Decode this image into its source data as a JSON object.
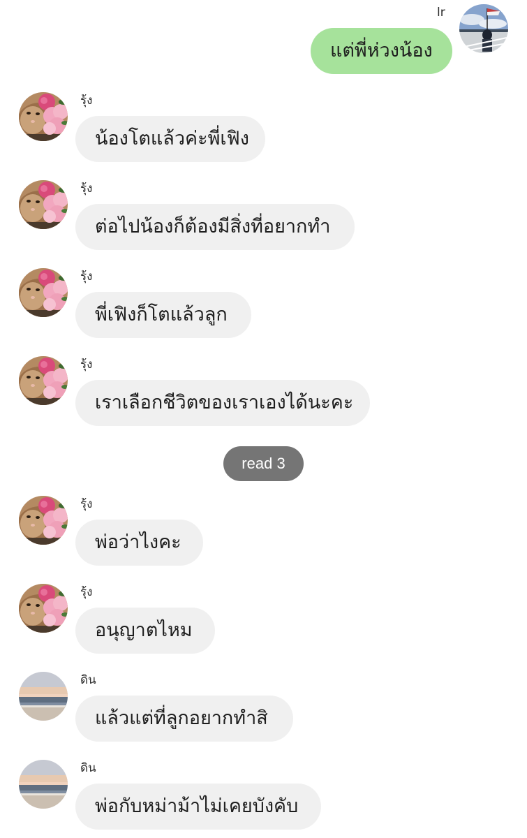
{
  "outgoing": {
    "sender_name": "lr",
    "text": "แต่พี่ห่วงน้อง",
    "avatar": "sea-view-photo-avatar"
  },
  "messages": [
    {
      "sender": "รุ้ง",
      "text": "น้องโตแล้วค่ะพี่เฟิง",
      "avatar": "cat-with-flowers-avatar"
    },
    {
      "sender": "รุ้ง",
      "text": "ต่อไปน้องก็ต้องมีสิ่งที่อยากทำ",
      "avatar": "cat-with-flowers-avatar"
    },
    {
      "sender": "รุ้ง",
      "text": "พี่เฟิงก็โตแล้วลูก",
      "avatar": "cat-with-flowers-avatar"
    },
    {
      "sender": "รุ้ง",
      "text": "เราเลือกชีวิตของเราเองได้นะคะ",
      "avatar": "cat-with-flowers-avatar"
    },
    {
      "sender": "รุ้ง",
      "text": "พ่อว่าไงคะ",
      "avatar": "cat-with-flowers-avatar"
    },
    {
      "sender": "รุ้ง",
      "text": "อนุญาตไหม",
      "avatar": "cat-with-flowers-avatar"
    },
    {
      "sender": "ดิน",
      "text": "แล้วแต่ที่ลูกอยากทำสิ",
      "avatar": "sunset-sea-avatar"
    },
    {
      "sender": "ดิน",
      "text": "พ่อกับหม่าม้าไม่เคยบังคับ",
      "avatar": "sunset-sea-avatar"
    }
  ],
  "read_receipt": "read 3",
  "colors": {
    "incoming_bubble": "#f0f0f0",
    "outgoing_bubble": "#a6e29b",
    "read_pill": "#757575"
  }
}
